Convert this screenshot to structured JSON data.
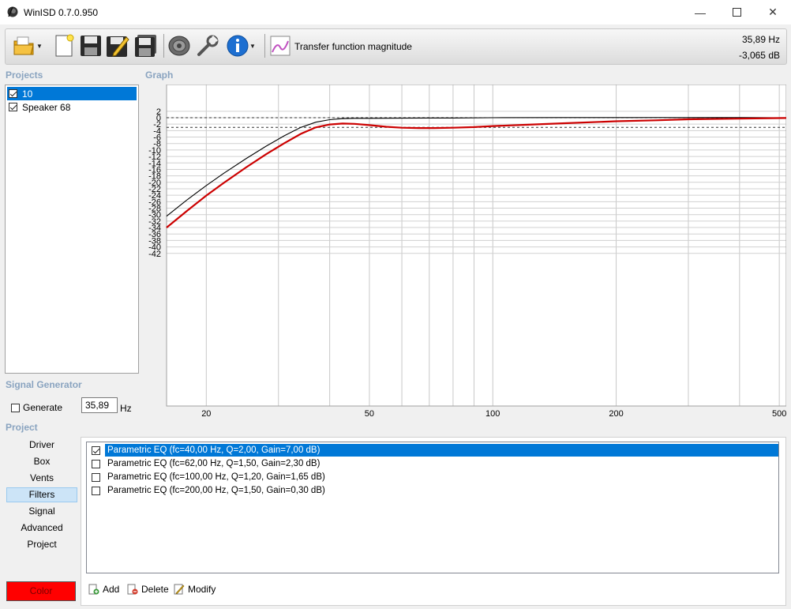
{
  "window": {
    "title": "WinISD 0.7.0.950"
  },
  "toolbar": {
    "icons": [
      "open-folder-icon",
      "new-file-icon",
      "save-icon",
      "edit-save-icon",
      "save-all-icon",
      "driver-icon",
      "wrench-icon",
      "info-icon",
      "graph-icon"
    ],
    "graph_label": "Transfer function magnitude",
    "readout_hz": "35,89 Hz",
    "readout_db": "-3,065 dB"
  },
  "projects": {
    "header": "Projects",
    "items": [
      {
        "label": "10",
        "checked": true,
        "selected": true
      },
      {
        "label": "Speaker 68",
        "checked": true,
        "selected": false
      }
    ]
  },
  "graph": {
    "header": "Graph"
  },
  "signal_generator": {
    "header": "Signal Generator",
    "generate_label": "Generate",
    "frequency": "35,89",
    "unit": "Hz"
  },
  "project_nav": {
    "header": "Project",
    "items": [
      "Driver",
      "Box",
      "Vents",
      "Filters",
      "Signal",
      "Advanced",
      "Project"
    ],
    "active": "Filters",
    "color_label": "Color",
    "color": "#ff0000"
  },
  "filters": {
    "items": [
      {
        "label": "Parametric EQ (fc=40,00 Hz, Q=2,00, Gain=7,00 dB)",
        "checked": true,
        "selected": true
      },
      {
        "label": "Parametric EQ (fc=62,00 Hz, Q=1,50, Gain=2,30 dB)",
        "checked": false,
        "selected": false
      },
      {
        "label": "Parametric EQ (fc=100,00 Hz, Q=1,20, Gain=1,65 dB)",
        "checked": false,
        "selected": false
      },
      {
        "label": "Parametric EQ (fc=200,00 Hz, Q=1,50, Gain=0,30 dB)",
        "checked": false,
        "selected": false
      }
    ],
    "add_label": "Add",
    "delete_label": "Delete",
    "modify_label": "Modify"
  },
  "chart_data": {
    "type": "line",
    "title": "",
    "xlabel": "",
    "ylabel": "",
    "xscale": "log",
    "xlim": [
      16,
      520
    ],
    "ylim": [
      -44,
      3
    ],
    "x_ticks": [
      20,
      50,
      100,
      200,
      500
    ],
    "x_tick_labels": [
      "20",
      "50",
      "100",
      "200",
      "500"
    ],
    "y_ticks": [
      2,
      0,
      -2,
      -4,
      -6,
      -8,
      -10,
      -12,
      -14,
      -16,
      -18,
      -20,
      -22,
      -24,
      -26,
      -28,
      -30,
      -32,
      -34,
      -36,
      -38,
      -40,
      -42
    ],
    "y_tick_labels": [
      "2",
      "0",
      "-2",
      "-4",
      "-6",
      "-8",
      "-10",
      "-12",
      "-14",
      "-16",
      "-18",
      "-20",
      "-22",
      "-24",
      "-26",
      "-28",
      "-30",
      "-32",
      "-34",
      "-36",
      "-38",
      "-40",
      "-42"
    ],
    "reference_lines": [
      0,
      -3
    ],
    "grid": true,
    "series": [
      {
        "color": "#000000",
        "x": [
          16,
          18,
          20,
          22,
          25,
          28,
          31,
          34,
          37,
          40,
          43,
          46,
          50,
          60,
          70,
          80,
          100,
          150,
          200,
          300,
          400,
          520
        ],
        "y": [
          -30.5,
          -25.3,
          -21.0,
          -17.3,
          -12.7,
          -8.8,
          -5.6,
          -3.0,
          -1.4,
          -0.6,
          -0.3,
          -0.2,
          -0.2,
          -0.15,
          -0.1,
          -0.1,
          0.0,
          0.05,
          0.05,
          0.05,
          0.05,
          0.0
        ]
      },
      {
        "color": "#cc0000",
        "x": [
          16,
          18,
          20,
          22,
          25,
          28,
          31,
          34,
          37,
          40,
          43,
          46,
          50,
          55,
          60,
          66,
          72,
          80,
          90,
          100,
          120,
          150,
          200,
          250,
          300,
          400,
          520
        ],
        "y": [
          -34.0,
          -28.7,
          -24.1,
          -20.3,
          -15.4,
          -11.3,
          -7.9,
          -5.0,
          -3.0,
          -2.1,
          -1.8,
          -1.9,
          -2.3,
          -2.8,
          -3.1,
          -3.2,
          -3.2,
          -3.1,
          -2.9,
          -2.6,
          -2.2,
          -1.7,
          -1.1,
          -0.8,
          -0.5,
          -0.3,
          -0.1
        ]
      }
    ]
  }
}
